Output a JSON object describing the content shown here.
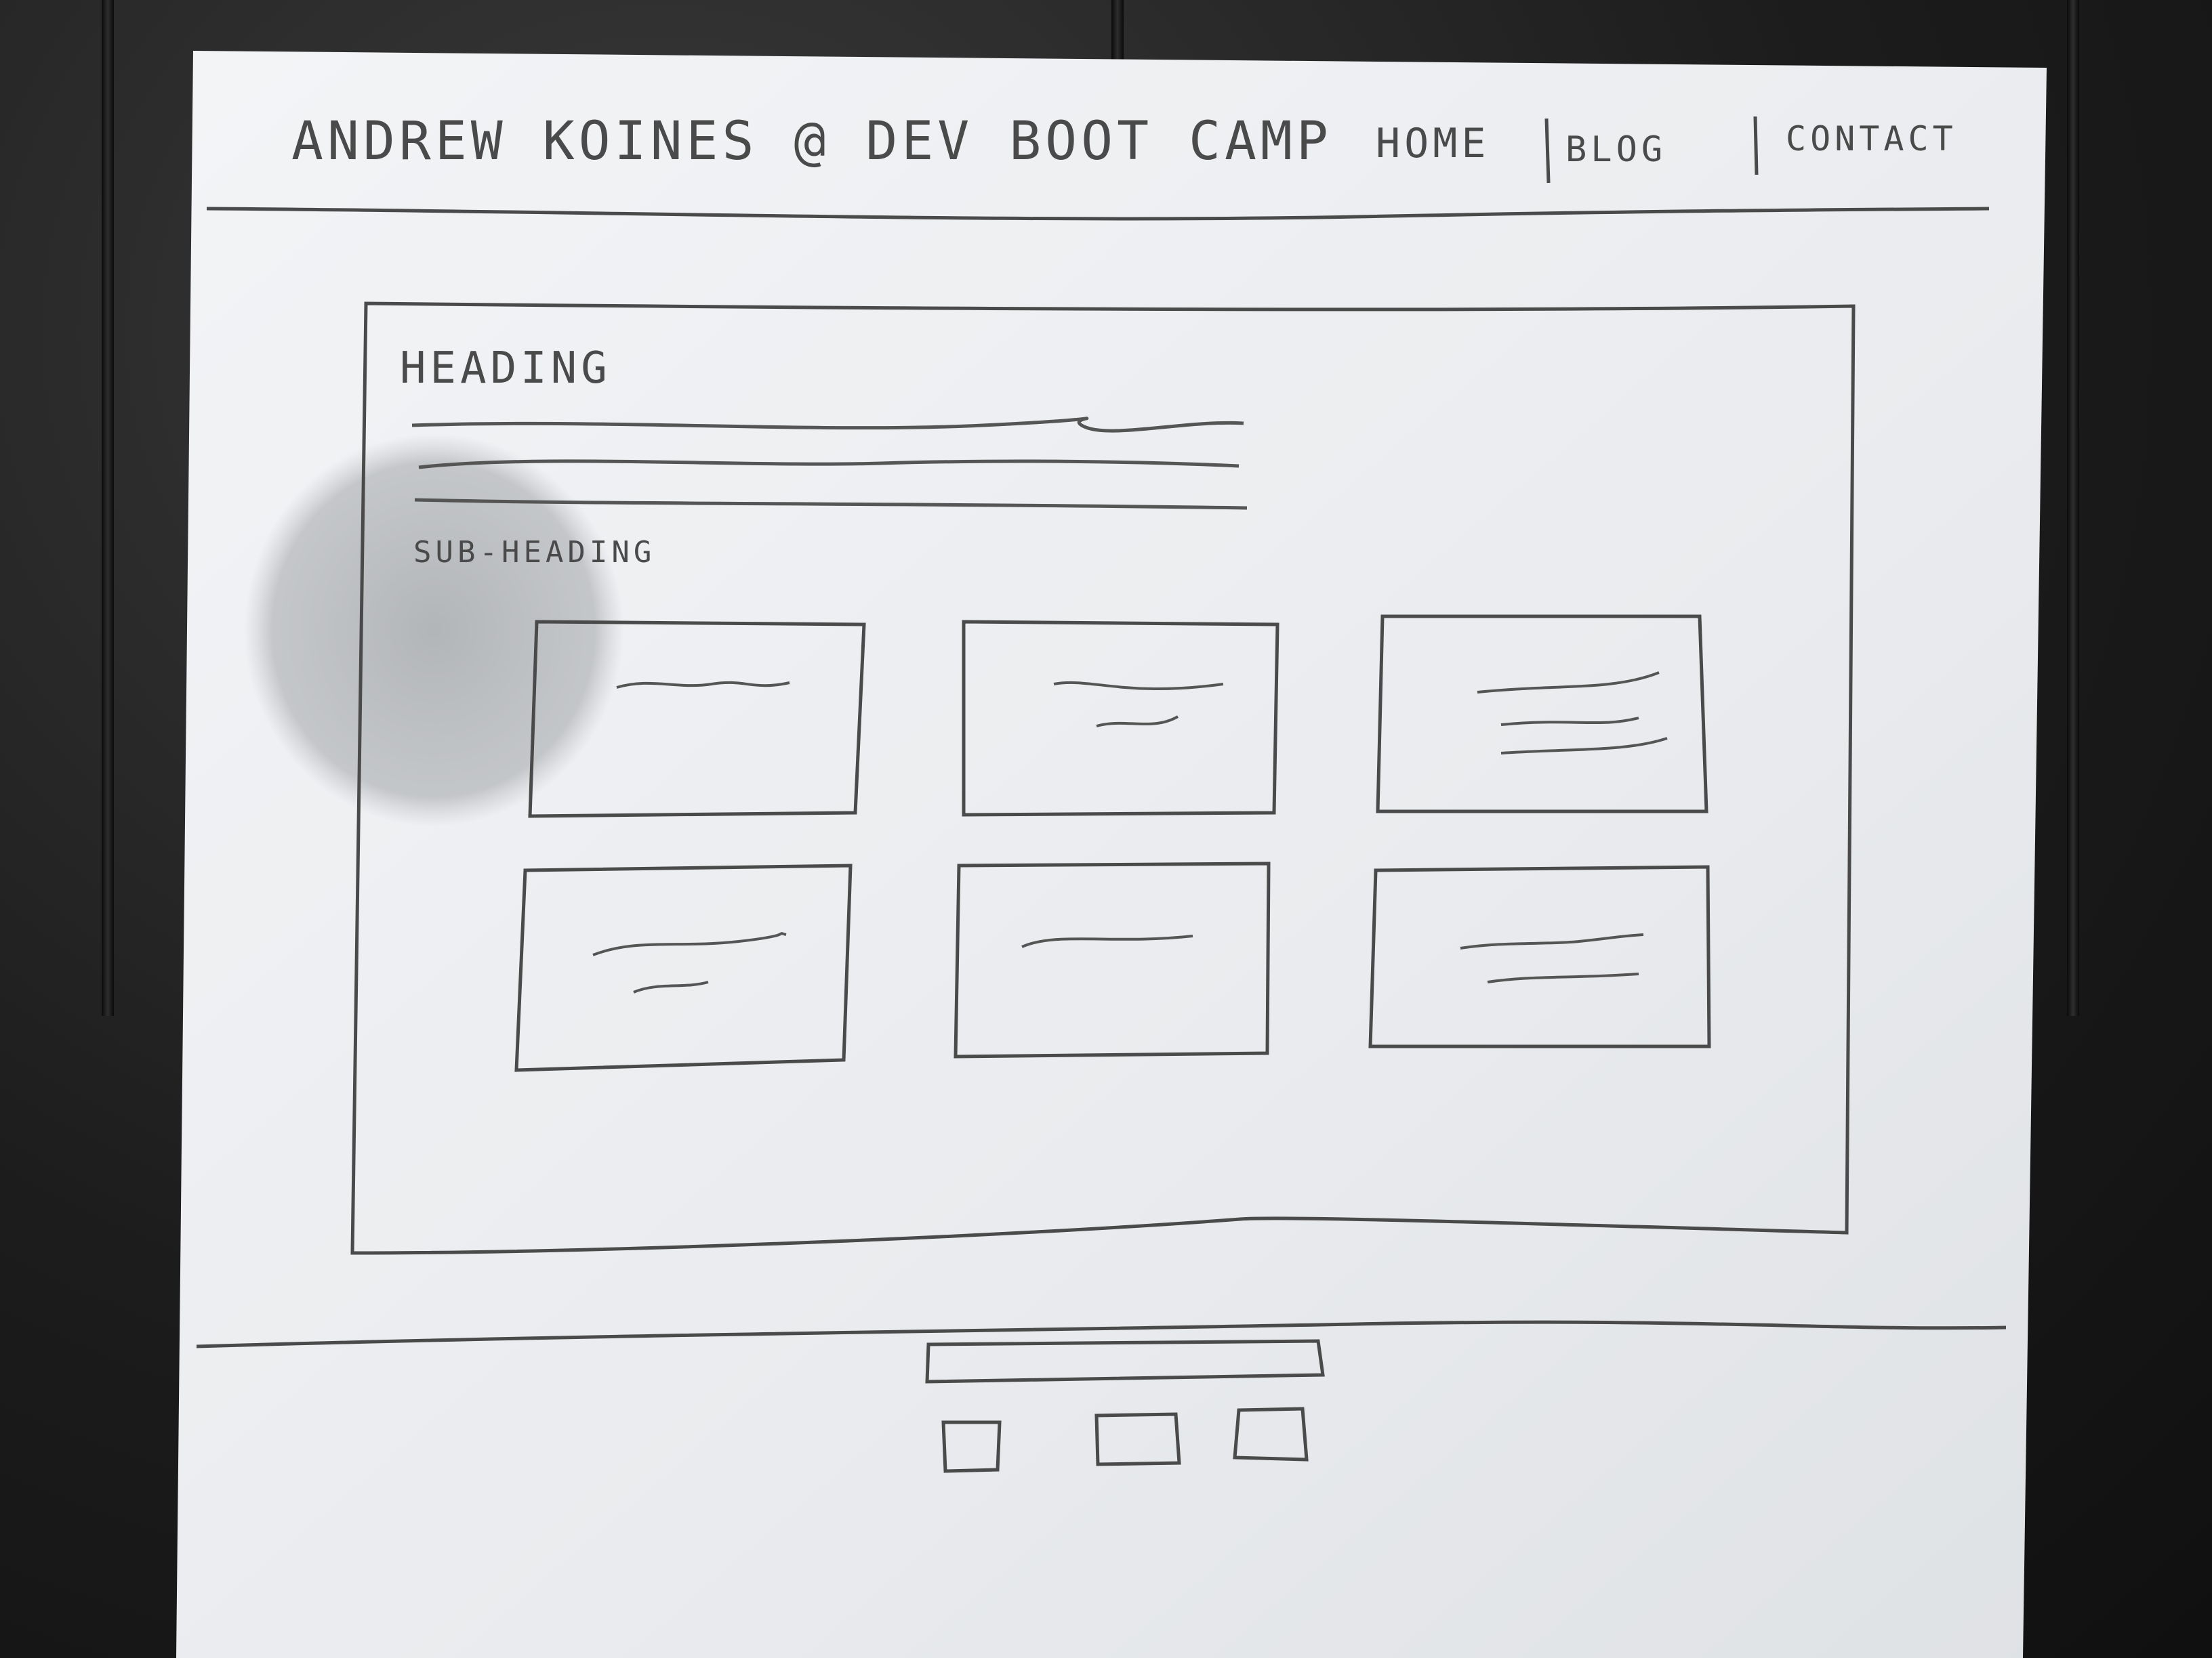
{
  "header": {
    "site_title": "ANDREW KOINES @ DEV BOOT CAMP",
    "nav": [
      "HOME",
      "BLOG",
      "CONTACT"
    ]
  },
  "main": {
    "heading": "HEADING",
    "subheading": "SUB-HEADING",
    "paragraph_lines": 3,
    "cards": [
      {
        "lines": 1
      },
      {
        "lines": 2
      },
      {
        "lines": 3
      },
      {
        "lines": 2
      },
      {
        "lines": 1
      },
      {
        "lines": 2
      }
    ]
  },
  "footer": {
    "bar": "footer-bar",
    "icons": [
      "social-icon",
      "social-icon",
      "social-icon"
    ]
  },
  "colors": {
    "paper": "#eceef0",
    "pencil": "#4a4a4a",
    "stain": "#9fa3a6",
    "background": "#1c1c1c"
  }
}
